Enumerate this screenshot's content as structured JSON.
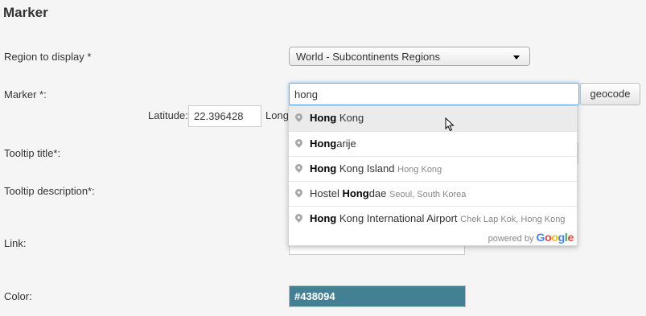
{
  "section_title": "Marker",
  "region": {
    "label": "Region to display *",
    "value": "World - Subcontinents Regions"
  },
  "marker": {
    "label": "Marker *:",
    "value": "hong",
    "geocode_label": "geocode"
  },
  "latitude": {
    "label": "Latitude:",
    "value": "22.396428"
  },
  "longitude": {
    "label_visible": "Longi"
  },
  "tooltip_title": {
    "label": "Tooltip title*:"
  },
  "tooltip_description": {
    "label": "Tooltip description*:"
  },
  "link": {
    "label": "Link:"
  },
  "color": {
    "label": "Color:",
    "value": "#438094"
  },
  "suggestions": [
    {
      "match": "Hong",
      "rest": " Kong",
      "secondary": ""
    },
    {
      "match": "Hong",
      "rest": "arije",
      "secondary": ""
    },
    {
      "match": "Hong",
      "rest": " Kong Island",
      "secondary": "Hong Kong"
    },
    {
      "prefix": "Hostel ",
      "match": "Hong",
      "rest": "dae",
      "secondary": "Seoul, South Korea"
    },
    {
      "match": "Hong",
      "rest": " Kong International Airport",
      "secondary": "Chek Lap Kok, Hong Kong"
    }
  ],
  "powered_by": {
    "text": "powered by",
    "brand": "Google"
  },
  "colors": {
    "accent": "#438094",
    "focus": "#66afe9",
    "google_blue": "#4285f4",
    "google_red": "#ea4335",
    "google_yellow": "#fbbc05",
    "google_green": "#34a853"
  }
}
